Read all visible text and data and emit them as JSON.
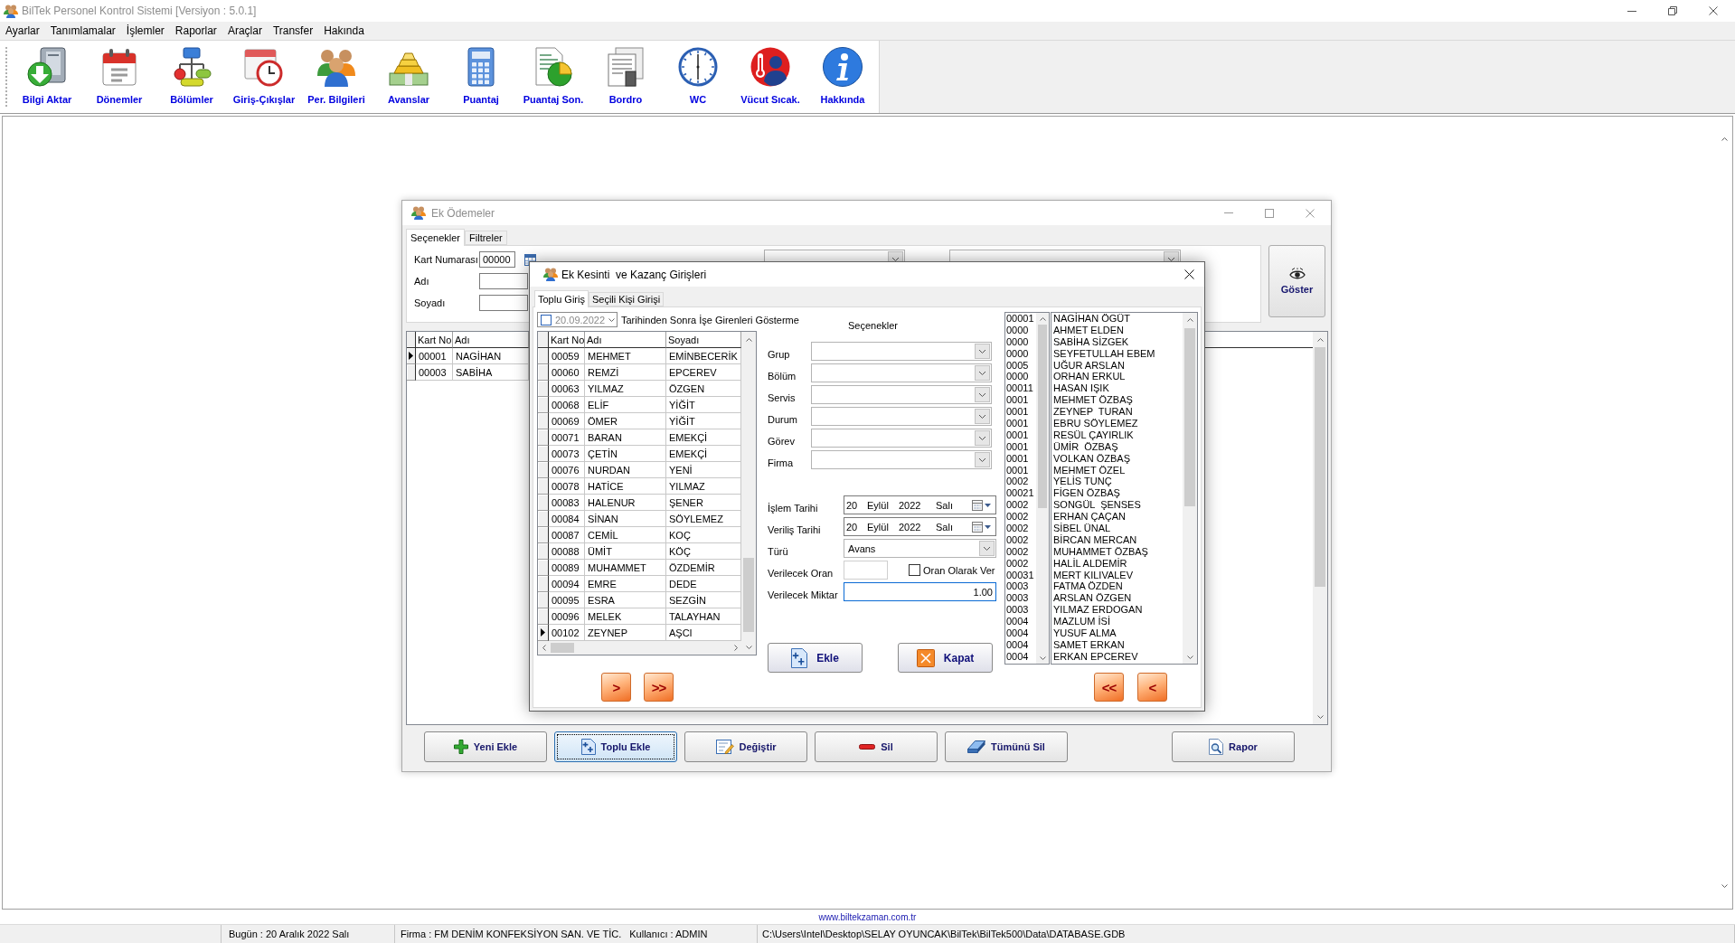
{
  "window": {
    "title": "BilTek Personel Kontrol Sistemi [Versiyon : 5.0.1]",
    "active": false
  },
  "menu": [
    "Ayarlar",
    "Tanımlamalar",
    "İşlemler",
    "Raporlar",
    "Araçlar",
    "Transfer",
    "Hakında"
  ],
  "toolbar": [
    "Bilgi Aktar",
    "Dönemler",
    "Bölümler",
    "Giriş-Çıkışlar",
    "Per. Bilgileri",
    "Avanslar",
    "Puantaj",
    "Puantaj Son.",
    "Bordro",
    "WC",
    "Vücut Sıcak.",
    "Hakkında"
  ],
  "ek_odemeler": {
    "title": "Ek Ödemeler",
    "active": false,
    "tabs": [
      {
        "label": "Seçenekler",
        "selected": true
      },
      {
        "label": "Filtreler",
        "selected": false
      }
    ],
    "fields": [
      {
        "label": "Kart Numarası",
        "kind": "code",
        "value": "00000"
      },
      {
        "label": "Adı",
        "kind": "text"
      },
      {
        "label": "Soyadı",
        "kind": "text"
      }
    ],
    "show_button": "Göster",
    "grid": {
      "columns": [
        "Kart No",
        "Adı"
      ],
      "rows": [
        {
          "cells": [
            "00001",
            "NAGİHAN"
          ],
          "selected": true
        },
        {
          "cells": [
            "00003",
            "SABİHA"
          ],
          "selected": false
        }
      ]
    },
    "buttons": [
      {
        "label": "Yeni Ekle",
        "focused": false
      },
      {
        "label": "Toplu Ekle",
        "focused": true
      },
      {
        "label": "Değiştir",
        "focused": false
      },
      {
        "label": "Sil",
        "focused": false
      },
      {
        "label": "Tümünü Sil",
        "focused": false
      },
      {
        "label": "Rapor",
        "focused": false
      }
    ]
  },
  "dialog": {
    "title": "Ek Kesinti  ve Kazanç Girişleri",
    "active": true,
    "tabs": [
      {
        "label": "Toplu Giriş",
        "selected": true
      },
      {
        "label": "Seçili Kişi Girişi",
        "selected": false
      }
    ],
    "date_filter": {
      "checked": false,
      "date": "20.09.2022",
      "label": "Tarihinden Sonra İşe Girenleri Gösterme"
    },
    "table": {
      "columns": [
        "Kart No",
        "Adı",
        "Soyadı"
      ],
      "rows": [
        {
          "cells": [
            "00059",
            "MEHMET",
            "EMİNBECERİK"
          ],
          "selected": false
        },
        {
          "cells": [
            "00060",
            "REMZİ",
            "EPCEREV"
          ],
          "selected": false
        },
        {
          "cells": [
            "00063",
            "YILMAZ",
            "ÖZGEN"
          ],
          "selected": false
        },
        {
          "cells": [
            "00068",
            "ELİF",
            "YİĞİT"
          ],
          "selected": false
        },
        {
          "cells": [
            "00069",
            "ÖMER",
            "YİĞİT"
          ],
          "selected": false
        },
        {
          "cells": [
            "00071",
            "BARAN",
            "EMEKÇİ"
          ],
          "selected": false
        },
        {
          "cells": [
            "00073",
            "ÇETİN",
            "EMEKÇİ"
          ],
          "selected": false
        },
        {
          "cells": [
            "00076",
            "NURDAN",
            "YENİ"
          ],
          "selected": false
        },
        {
          "cells": [
            "00078",
            "HATİCE",
            "YILMAZ"
          ],
          "selected": false
        },
        {
          "cells": [
            "00083",
            "HALENUR",
            "ŞENER"
          ],
          "selected": false
        },
        {
          "cells": [
            "00084",
            "SİNAN",
            "SÖYLEMEZ"
          ],
          "selected": false
        },
        {
          "cells": [
            "00087",
            "CEMİL",
            "KOÇ"
          ],
          "selected": false
        },
        {
          "cells": [
            "00088",
            "ÜMİT",
            "KÖÇ"
          ],
          "selected": false
        },
        {
          "cells": [
            "00089",
            "MUHAMMET",
            "ÖZDEMİR"
          ],
          "selected": false
        },
        {
          "cells": [
            "00094",
            "EMRE",
            "DEDE"
          ],
          "selected": false
        },
        {
          "cells": [
            "00095",
            "ESRA",
            "SEZGİN"
          ],
          "selected": false
        },
        {
          "cells": [
            "00096",
            "MELEK",
            "TALAYHAN"
          ],
          "selected": false
        },
        {
          "cells": [
            "00102",
            "ZEYNEP",
            "AŞCI"
          ],
          "selected": true
        }
      ]
    },
    "add_buttons": [
      ">",
      ">>"
    ],
    "options": {
      "title": "Seçenekler",
      "filters": [
        "Grup",
        "Bölüm",
        "Servis",
        "Durum",
        "Görev",
        "Firma"
      ]
    },
    "dates": [
      {
        "label": "İşlem Tarihi",
        "day": "20",
        "month": "Eylül",
        "year": "2022",
        "weekday": "Salı"
      },
      {
        "label": "Veriliş Tarihi",
        "day": "20",
        "month": "Eylül",
        "year": "2022",
        "weekday": "Salı"
      }
    ],
    "type": {
      "label": "Türü",
      "value": "Avans"
    },
    "rate": {
      "label": "Verilecek Oran",
      "disabled": true,
      "option": {
        "label": "Oran Olarak Ver",
        "checked": false
      }
    },
    "amount": {
      "label": "Verilecek Miktar",
      "value": "1.00",
      "focused": true
    },
    "actions": [
      "Ekle",
      "Kapat"
    ],
    "selected_people": [
      {
        "code": "00001",
        "name": "NAGİHAN ÖGÜT"
      },
      {
        "code": "0000",
        "name": "AHMET ELDEN"
      },
      {
        "code": "0000",
        "name": "SABİHA SİZGEK"
      },
      {
        "code": "0000",
        "name": "SEYFETULLAH EBEM"
      },
      {
        "code": "0005",
        "name": "UĞUR ARSLAN"
      },
      {
        "code": "0000",
        "name": "ORHAN ERKUL"
      },
      {
        "code": "00011",
        "name": "HASAN IŞIK"
      },
      {
        "code": "0001",
        "name": "MEHMET ÖZBAŞ"
      },
      {
        "code": "0001",
        "name": "ZEYNEP  TURAN"
      },
      {
        "code": "0001",
        "name": "EBRU SÖYLEMEZ"
      },
      {
        "code": "0001",
        "name": "RESÜL ÇAYIRLIK"
      },
      {
        "code": "0001",
        "name": "ÜMİR  ÖZBAŞ"
      },
      {
        "code": "0001",
        "name": "VOLKAN ÖZBAŞ"
      },
      {
        "code": "0001",
        "name": "MEHMET ÖZEL"
      },
      {
        "code": "0002",
        "name": "YELİS TUNÇ"
      },
      {
        "code": "00021",
        "name": "FİGEN ÖZBAŞ"
      },
      {
        "code": "0002",
        "name": "SONGÜL  ŞENSES"
      },
      {
        "code": "0002",
        "name": "ERHAN ÇAÇAN"
      },
      {
        "code": "0002",
        "name": "SİBEL ÜNAL"
      },
      {
        "code": "0002",
        "name": "BİRCAN MERCAN"
      },
      {
        "code": "0002",
        "name": "MUHAMMET ÖZBAŞ"
      },
      {
        "code": "0002",
        "name": "HALİL ALDEMİR"
      },
      {
        "code": "00031",
        "name": "MERT KILIVALEV"
      },
      {
        "code": "0003",
        "name": "FATMA ÖZDEN"
      },
      {
        "code": "0003",
        "name": "ARSLAN ÖZGEN"
      },
      {
        "code": "0003",
        "name": "YILMAZ ERDOGAN"
      },
      {
        "code": "0004",
        "name": "MAZLUM İSİ"
      },
      {
        "code": "0004",
        "name": "YUSUF ALMA"
      },
      {
        "code": "0004",
        "name": "SAMET ERKAN"
      },
      {
        "code": "0004",
        "name": "ERKAN EPCEREV"
      }
    ],
    "remove_buttons": [
      "<<",
      "<"
    ]
  },
  "footer": {
    "link": "www.biltekzaman.com.tr"
  },
  "status_bar": {
    "date": "Bugün : 20 Aralık 2022 Salı",
    "company": "Firma : FM DENİM KONFEKSİYON SAN. VE TİC.",
    "user": "Kullanıcı : ADMIN",
    "path": "C:\\Users\\Intel\\Desktop\\SELAY OYUNCAK\\BilTek\\BilTek500\\Data\\DATABASE.GDB"
  }
}
